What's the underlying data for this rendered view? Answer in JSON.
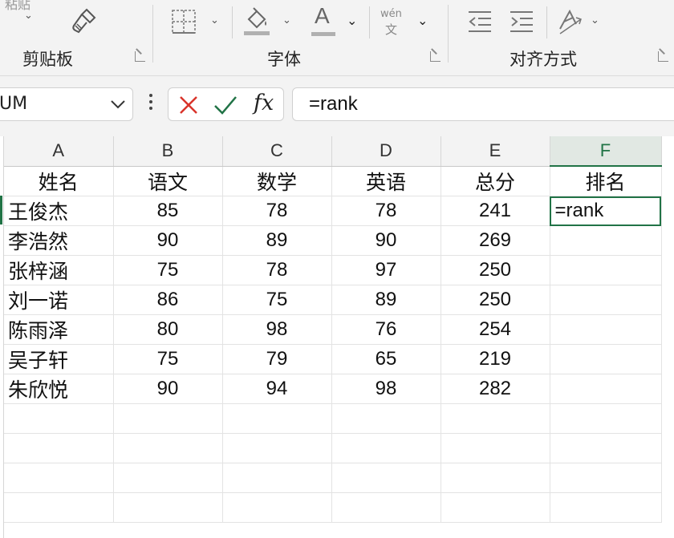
{
  "ribbon": {
    "paste_label": "粘贴",
    "groups": [
      {
        "label": "剪贴板"
      },
      {
        "label": "字体"
      },
      {
        "label": "对齐方式"
      }
    ],
    "phonetic_top": "wén",
    "phonetic_bottom": "文",
    "font_color_glyph": "A",
    "font_color_accent": "#c00000"
  },
  "formula_bar": {
    "name_box": "UM",
    "fx_label": "fx",
    "formula": "=rank"
  },
  "columns": [
    "A",
    "B",
    "C",
    "D",
    "E",
    "F"
  ],
  "active_column": "F",
  "header_row": [
    "姓名",
    "语文",
    "数学",
    "英语",
    "总分",
    "排名"
  ],
  "rows": [
    {
      "name": "王俊杰",
      "chinese": "85",
      "math": "78",
      "english": "78",
      "total": "241",
      "rank": "=rank"
    },
    {
      "name": "李浩然",
      "chinese": "90",
      "math": "89",
      "english": "90",
      "total": "269",
      "rank": ""
    },
    {
      "name": "张梓涵",
      "chinese": "75",
      "math": "78",
      "english": "97",
      "total": "250",
      "rank": ""
    },
    {
      "name": "刘一诺",
      "chinese": "86",
      "math": "75",
      "english": "89",
      "total": "250",
      "rank": ""
    },
    {
      "name": "陈雨泽",
      "chinese": "80",
      "math": "98",
      "english": "76",
      "total": "254",
      "rank": ""
    },
    {
      "name": "吴子轩",
      "chinese": "75",
      "math": "79",
      "english": "65",
      "total": "219",
      "rank": ""
    },
    {
      "name": "朱欣悦",
      "chinese": "90",
      "math": "94",
      "english": "98",
      "total": "282",
      "rank": ""
    }
  ],
  "colors": {
    "accent": "#217346",
    "cancel": "#d9342b",
    "confirm": "#217346"
  }
}
